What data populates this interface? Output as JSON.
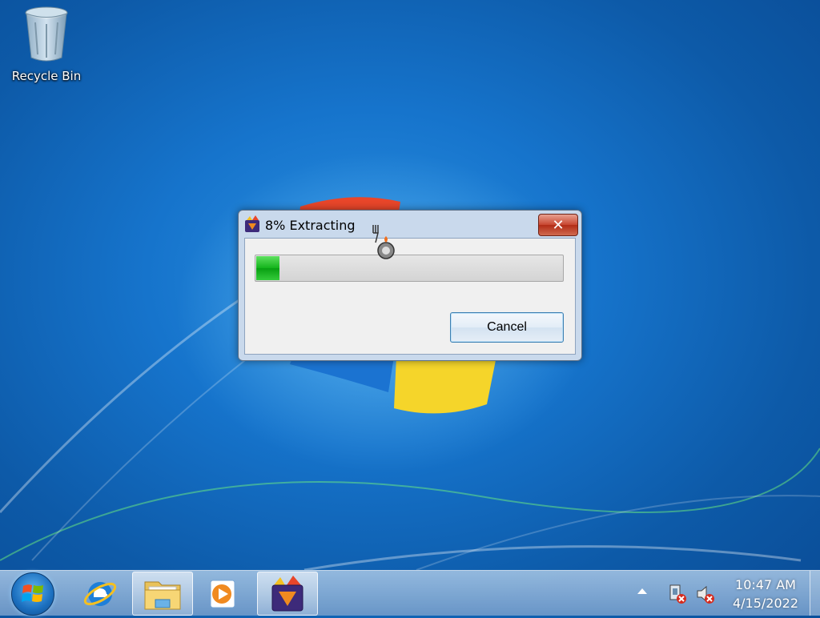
{
  "desktop": {
    "icons": [
      {
        "label": "Recycle Bin",
        "icon": "recycle-bin-icon"
      }
    ]
  },
  "dialog": {
    "title": "8% Extracting",
    "app_icon": "archive-app-icon",
    "progress_percent": 8,
    "progress_color": "#13b41c",
    "cancel_label": "Cancel",
    "close_symbol": "✕"
  },
  "taskbar": {
    "pinned": [
      {
        "name": "start-button",
        "icon": "windows-logo-icon"
      },
      {
        "name": "internet-explorer",
        "icon": "internet-explorer-icon"
      },
      {
        "name": "windows-explorer",
        "icon": "folder-icon"
      },
      {
        "name": "windows-media-player",
        "icon": "media-player-icon"
      },
      {
        "name": "archive-app",
        "icon": "archive-app-icon",
        "active": true
      }
    ],
    "tray": {
      "icons": [
        "show-hidden-icons-arrow",
        "network-error-icon",
        "volume-muted-icon"
      ]
    },
    "clock": {
      "time": "10:47 AM",
      "date": "4/15/2022"
    }
  }
}
